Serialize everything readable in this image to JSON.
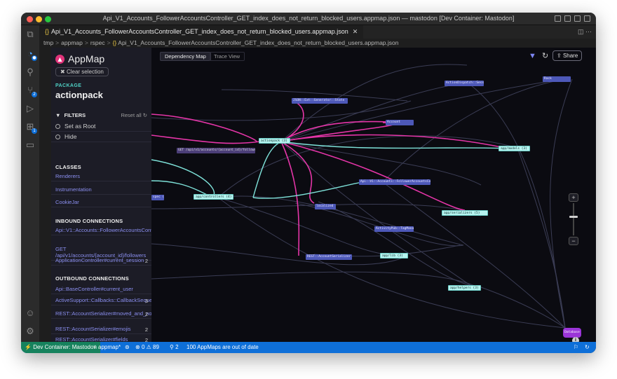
{
  "window": {
    "title": "Api_V1_Accounts_FollowerAccountsController_GET_index_does_not_return_blocked_users.appmap.json — mastodon [Dev Container: Mastodon]"
  },
  "tab": {
    "label": "Api_V1_Accounts_FollowerAccountsController_GET_index_does_not_return_blocked_users.appmap.json",
    "icon": "json-braces-icon"
  },
  "breadcrumb": {
    "items": [
      "tmp",
      "appmap",
      "rspec",
      "Api_V1_Accounts_FollowerAccountsController_GET_index_does_not_return_blocked_users.appmap.json"
    ]
  },
  "appmap": {
    "brand": "AppMap",
    "clear_selection": "Clear selection",
    "package_label": "PACKAGE",
    "package_name": "actionpack",
    "filters_label": "FILTERS",
    "reset_all": "Reset all",
    "options": [
      "Set as Root",
      "Hide"
    ],
    "classes_label": "CLASSES",
    "classes": [
      "Renderers",
      "Instrumentation",
      "CookieJar"
    ],
    "inbound_label": "INBOUND CONNECTIONS",
    "inbound": [
      {
        "label": "Api::V1::Accounts::FollowerAccountsController#index",
        "count": ""
      },
      {
        "label": "GET /api/v1/accounts/{account_id}/followers",
        "count": ""
      },
      {
        "label": "ApplicationController#current_session",
        "count": "2"
      }
    ],
    "outbound_label": "OUTBOUND CONNECTIONS",
    "outbound": [
      {
        "label": "Api::BaseController#current_user",
        "count": ""
      },
      {
        "label": "ActiveSupport::Callbacks::CallbackSequence#invoke_before",
        "count": "3"
      },
      {
        "label": "REST::AccountSerializer#moved_and_not_nested?",
        "count": "2"
      },
      {
        "label": "REST::AccountSerializer#emojis",
        "count": "2"
      },
      {
        "label": "REST::AccountSerializer#fields",
        "count": "2"
      },
      {
        "label": "REST::AccountSerializer#id",
        "count": ""
      }
    ]
  },
  "map": {
    "tabs": [
      "Dependency Map",
      "Trace View"
    ],
    "share": "Share",
    "nodes": {
      "actioncontroller": "ActionDispatch::Session",
      "rack": "Rack",
      "json": "JSON::Ext::Generator::State",
      "account": "Account",
      "actionpack": "actionpack (3)",
      "app_models": "app/models (3)",
      "get_route": "GET /api/v1/accounts/{account_id}/followers",
      "follower_controller": "Api::V1::Accounts::FollowerAccountsController",
      "spec": "spec (3)",
      "app_controllers": "app/controllers (4)",
      "localized": "localized",
      "app_serializers": "app/serializers (5)",
      "activity_pub": "ActivityPub::TagManager",
      "rest_account": "REST::AccountSerializer",
      "app_lib": "app/lib (3)",
      "app_helpers": "app/helpers (3)",
      "database": "Database"
    }
  },
  "statusbar": {
    "remote": "Dev Container: Mastodon",
    "branch": "appmap*",
    "sync": "⊚",
    "errors": "0",
    "warnings": "89",
    "ports": "2",
    "message": "100 AppMaps are out of date"
  }
}
